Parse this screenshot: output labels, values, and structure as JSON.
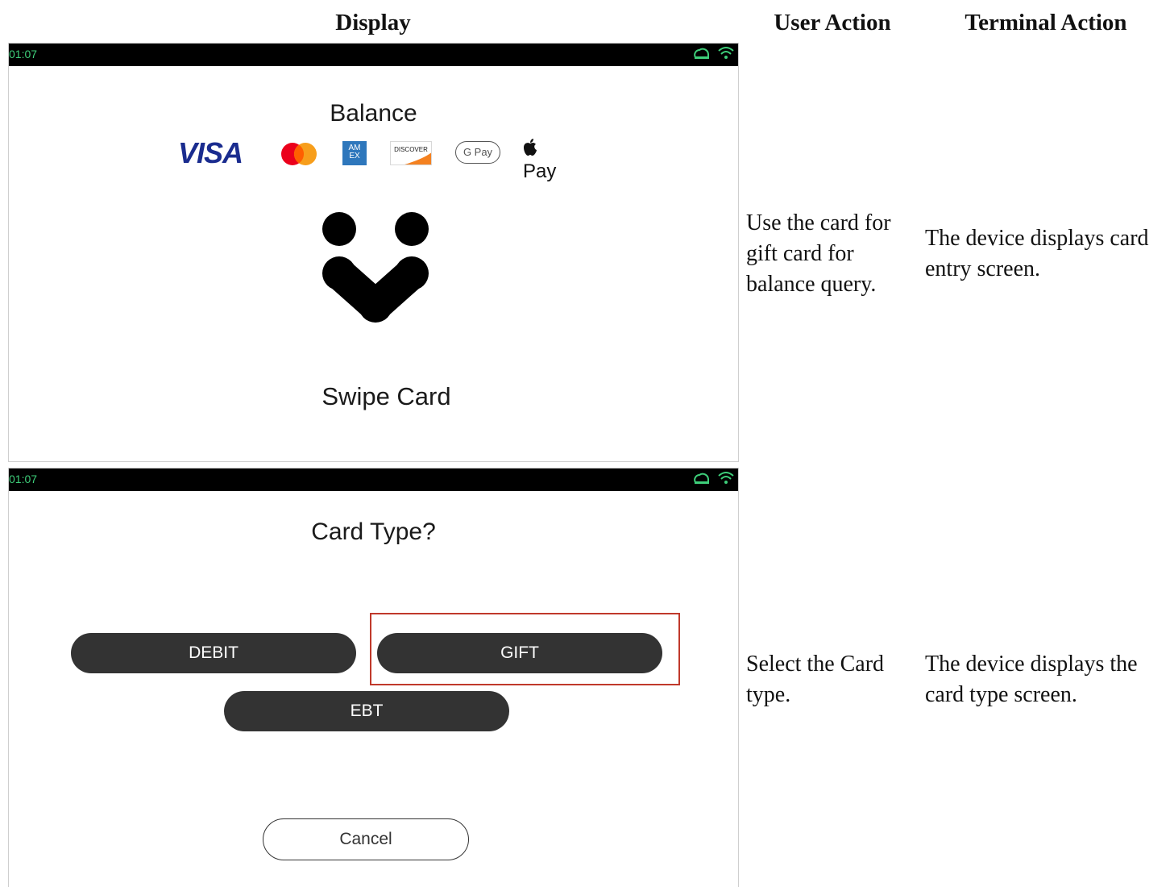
{
  "table": {
    "headers": {
      "display": "Display",
      "user_action": "User Action",
      "terminal_action": "Terminal Action"
    },
    "rows": [
      {
        "user_action": "Use the card for gift card for balance query.",
        "terminal_action": "The device displays card entry screen."
      },
      {
        "user_action": "Select the Card type.",
        "terminal_action": "The device displays the card type screen."
      }
    ]
  },
  "screen1": {
    "status_time": "01:07",
    "title": "Balance",
    "brands": {
      "visa": "VISA",
      "amex": "AM EX",
      "discover": "DISCOVER",
      "gpay": "G Pay",
      "applepay": "Pay"
    },
    "prompt": "Swipe Card"
  },
  "screen2": {
    "status_time": "01:07",
    "title": "Card Type?",
    "buttons": {
      "debit": "DEBIT",
      "gift": "GIFT",
      "ebt": "EBT",
      "cancel": "Cancel"
    }
  },
  "colors": {
    "status_green": "#3ecf7a",
    "button_dark": "#333333",
    "highlight_red": "#c0392b"
  }
}
